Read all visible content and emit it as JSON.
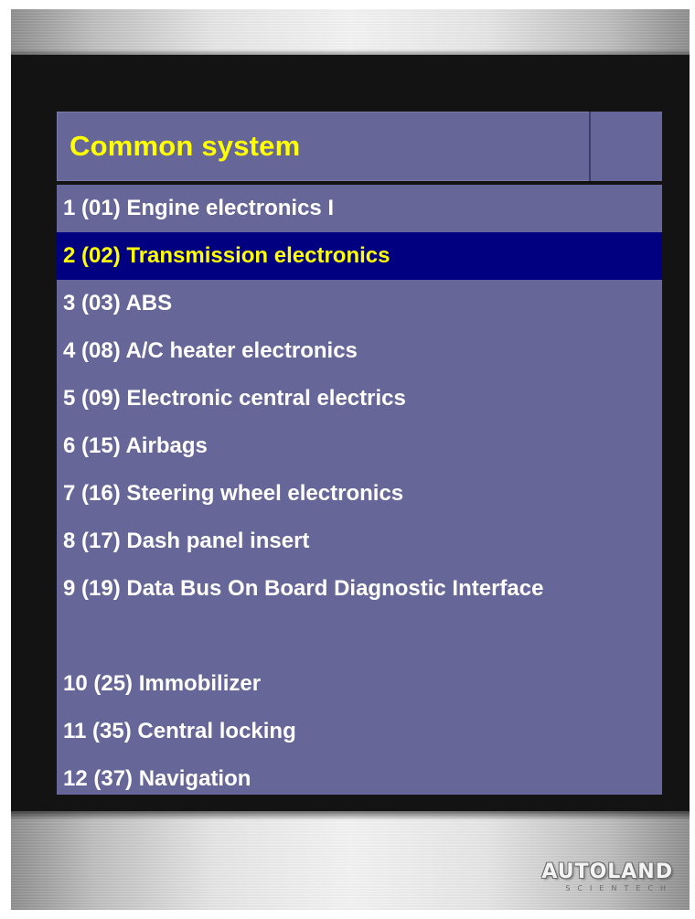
{
  "header": {
    "title": "Common system"
  },
  "menu": {
    "items": [
      {
        "label": "1 (01) Engine electronics I"
      },
      {
        "label": "2 (02) Transmission electronics"
      },
      {
        "label": "3 (03) ABS"
      },
      {
        "label": "4 (08) A/C heater electronics"
      },
      {
        "label": "5 (09) Electronic central electrics"
      },
      {
        "label": "6 (15) Airbags"
      },
      {
        "label": "7 (16) Steering wheel electronics"
      },
      {
        "label": "8 (17) Dash panel insert"
      },
      {
        "label": "9 (19) Data Bus On Board Diagnostic Interface"
      },
      {
        "label": "10 (25) Immobilizer"
      },
      {
        "label": "11 (35) Central locking"
      },
      {
        "label": "12 (37) Navigation"
      }
    ],
    "selected_index": 1
  },
  "brand": {
    "name": "AUTOLAND",
    "subtitle": "SCIENTECH"
  },
  "colors": {
    "panel": "#666699",
    "selection": "#000080",
    "title_text": "#ffff00",
    "item_text": "#ffffff"
  }
}
